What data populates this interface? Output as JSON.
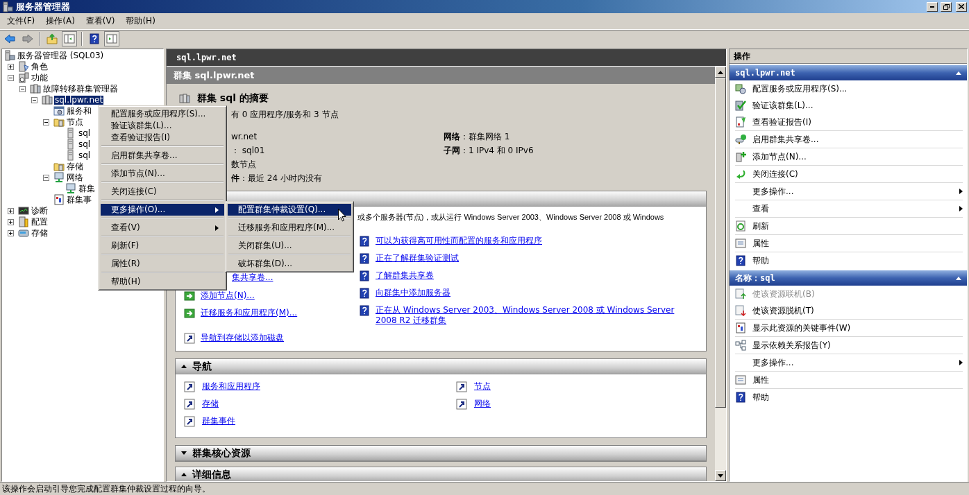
{
  "window": {
    "title": "服务器管理器"
  },
  "menu_bar": [
    "文件(F)",
    "操作(A)",
    "查看(V)",
    "帮助(H)"
  ],
  "toolbar": [
    {
      "disabled": false,
      "pressed": false
    },
    {
      "disabled": true,
      "pressed": false
    },
    {
      "disabled": false,
      "pressed": false
    },
    {
      "disabled": false,
      "pressed": true
    },
    {
      "disabled": false,
      "pressed": false
    },
    {
      "disabled": false,
      "pressed": true
    }
  ],
  "tree": [
    {
      "label": "服务器管理器 (SQL03)",
      "selected": false,
      "children": [
        {
          "label": "角色",
          "expanded": false,
          "selected": false
        },
        {
          "label": "功能",
          "expanded": true,
          "selected": false,
          "children": [
            {
              "label": "故障转移群集管理器",
              "expanded": true,
              "selected": false,
              "children": [
                {
                  "label": "sql.lpwr.net",
                  "expanded": true,
                  "selected": true,
                  "children": [
                    {
                      "label": "服务和",
                      "selected": false
                    },
                    {
                      "label": "节点",
                      "expanded": true,
                      "selected": false,
                      "children": [
                        {
                          "label": "sql",
                          "selected": false
                        },
                        {
                          "label": "sql",
                          "selected": false
                        },
                        {
                          "label": "sql",
                          "selected": false
                        }
                      ]
                    },
                    {
                      "label": "存储",
                      "selected": false
                    },
                    {
                      "label": "网络",
                      "expanded": true,
                      "selected": false,
                      "children": [
                        {
                          "label": "群集",
                          "selected": false
                        }
                      ]
                    },
                    {
                      "label": "群集事",
                      "selected": false
                    }
                  ]
                }
              ]
            }
          ]
        },
        {
          "label": "诊断",
          "expanded": false,
          "selected": false
        },
        {
          "label": "配置",
          "expanded": false,
          "selected": false
        },
        {
          "label": "存储",
          "expanded": false,
          "selected": false
        }
      ]
    }
  ],
  "context_menu": {
    "groups": [
      [
        {
          "label": "配置服务或应用程序(S)...",
          "selected": false,
          "submenu": false
        },
        {
          "label": "验证该群集(L)...",
          "selected": false,
          "submenu": false
        },
        {
          "label": "查看验证报告(I)",
          "selected": false,
          "submenu": false
        }
      ],
      [
        {
          "label": "启用群集共享卷...",
          "selected": false,
          "submenu": false
        }
      ],
      [
        {
          "label": "添加节点(N)...",
          "selected": false,
          "submenu": false
        }
      ],
      [
        {
          "label": "关闭连接(C)",
          "selected": false,
          "submenu": false
        }
      ],
      [
        {
          "label": "更多操作(O)...",
          "selected": true,
          "submenu": true
        }
      ],
      [
        {
          "label": "查看(V)",
          "selected": false,
          "submenu": true
        }
      ],
      [
        {
          "label": "刷新(F)",
          "selected": false,
          "submenu": false
        }
      ],
      [
        {
          "label": "属性(R)",
          "selected": false,
          "submenu": false
        }
      ],
      [
        {
          "label": "帮助(H)",
          "selected": false,
          "submenu": false
        }
      ]
    ]
  },
  "context_submenu": {
    "groups": [
      [
        {
          "label": "配置群集仲裁设置(Q)...",
          "selected": true,
          "submenu": false
        }
      ],
      [
        {
          "label": "迁移服务和应用程序(M)...",
          "selected": false,
          "submenu": false
        }
      ],
      [
        {
          "label": "关闭群集(U)...",
          "selected": false,
          "submenu": false
        }
      ],
      [
        {
          "label": "破坏群集(D)...",
          "selected": false,
          "submenu": false
        }
      ]
    ]
  },
  "content": {
    "header": "sql.lpwr.net",
    "title": "群集 sql.lpwr.net",
    "summary": {
      "heading": "群集 sql 的摘要",
      "line": "有 0 应用程序/服务和 3 节点",
      "left": [
        "wr.net",
        "： sql01",
        "数节点",
        "**件**：最近 24 小时内没有"
      ],
      "right": [
        "**网络**：群集网络 1",
        "**子网**：1 IPv4 和 0 IPv6"
      ]
    },
    "configure": {
      "intro": "或多个服务器(节点)，或从运行 Windows Server 2003、Windows Server 2008 或 Windows",
      "links_left": [
        {
          "label": "集共享卷...",
          "kind": "covered"
        },
        {
          "label": "添加节点(N)...",
          "kind": "action"
        },
        {
          "label": "迁移服务和应用程序(M)...",
          "kind": "action"
        },
        {
          "label": "导航到存储以添加磁盘",
          "kind": "navigate"
        }
      ],
      "links_right": [
        "可以为获得高可用性而配置的服务和应用程序",
        "正在了解群集验证测试",
        "了解群集共享卷",
        "向群集中添加服务器",
        "正在从 Windows Server 2003、Windows Server 2008 或 Windows Server 2008 R2 迁移群集"
      ]
    },
    "navigation": {
      "title": "导航",
      "expanded": true,
      "links": [
        "服务和应用程序",
        "节点",
        "存储",
        "网络",
        "群集事件"
      ]
    },
    "core_resources": {
      "title": "群集核心资源",
      "expanded": false
    },
    "details": {
      "title": "详细信息",
      "expanded": true
    }
  },
  "actions": {
    "title": "操作",
    "sections": [
      {
        "title": "sql.lpwr.net",
        "expanded": true,
        "groups": [
          [
            {
              "label": "配置服务或应用程序(S)...",
              "disabled": false,
              "submenu": false
            },
            {
              "label": "验证该群集(L)...",
              "disabled": false,
              "submenu": false
            },
            {
              "label": "查看验证报告(I)",
              "disabled": false,
              "submenu": false
            }
          ],
          [
            {
              "label": "启用群集共享卷...",
              "disabled": false,
              "submenu": false
            }
          ],
          [
            {
              "label": "添加节点(N)...",
              "disabled": false,
              "submenu": false
            }
          ],
          [
            {
              "label": "关闭连接(C)",
              "disabled": false,
              "submenu": false
            }
          ],
          [
            {
              "label": "更多操作...",
              "disabled": false,
              "submenu": true
            }
          ],
          [
            {
              "label": "查看",
              "disabled": false,
              "submenu": true
            }
          ],
          [
            {
              "label": "刷新",
              "disabled": false,
              "submenu": false
            }
          ],
          [
            {
              "label": "属性",
              "disabled": false,
              "submenu": false
            }
          ],
          [
            {
              "label": "帮助",
              "disabled": false,
              "submenu": false
            }
          ]
        ]
      },
      {
        "title": "名称：sql",
        "expanded": true,
        "groups": [
          [
            {
              "label": "使该资源联机(B)",
              "disabled": true,
              "submenu": false
            },
            {
              "label": "使该资源脱机(T)",
              "disabled": false,
              "submenu": false
            }
          ],
          [
            {
              "label": "显示此资源的关键事件(W)",
              "disabled": false,
              "submenu": false
            }
          ],
          [
            {
              "label": "显示依赖关系报告(Y)",
              "disabled": false,
              "submenu": false
            }
          ],
          [
            {
              "label": "更多操作...",
              "disabled": false,
              "submenu": true
            }
          ],
          [
            {
              "label": "属性",
              "disabled": false,
              "submenu": false
            }
          ],
          [
            {
              "label": "帮助",
              "disabled": false,
              "submenu": false
            }
          ]
        ]
      }
    ]
  },
  "status_bar": "该操作会启动引导您完成配置群集仲裁设置过程的向导。"
}
